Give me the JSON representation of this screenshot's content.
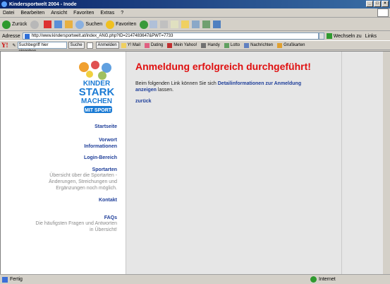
{
  "window": {
    "title": "Kindersportwelt 2004 - Inode"
  },
  "menu": {
    "items": [
      "Datei",
      "Bearbeiten",
      "Ansicht",
      "Favoriten",
      "Extras",
      "?"
    ]
  },
  "toolbar": {
    "back_label": "Zurück",
    "search_label": "Suchen",
    "favorites_label": "Favoriten"
  },
  "address": {
    "label": "Adresse",
    "url": "http://www.kindersportwelt.at/index_ANG.php?ID=2147483647&PWT=7733",
    "go_label": "Wechseln zu",
    "links_label": "Links"
  },
  "yahoo": {
    "logo": "Y!",
    "search_placeholder": "Suchbegriff hier eingeben",
    "search_button": "Suche",
    "login_button": "Anmelden",
    "items": [
      "Y! Mail",
      "Dating",
      "Mein Yahoo!",
      "Handy",
      "Lotto",
      "Nachrichten",
      "Grußkarten"
    ]
  },
  "logo": {
    "line1": "KINDER",
    "line2": "STARK",
    "line3": "MACHEN",
    "line4": "MIT SPORT"
  },
  "sidebar": {
    "startseite": "Startseite",
    "vorwort": "Vorwort Informationen",
    "login": "Login-Bereich",
    "sportarten": "Sportarten",
    "sportarten_desc": "Übersicht über die Sportarten - Änderungen, Streichungen und Ergänzungen noch möglich.",
    "kontakt": "Kontakt",
    "faqs": "FAQs",
    "faqs_desc": "Die häufigsten Fragen und Antworten in Übersicht!"
  },
  "main": {
    "heading": "Anmeldung erfolgreich durchgeführt!",
    "para_before": "Beim folgenden Link können Sie sich ",
    "para_link": "Detailinformationen zur Anmeldung anzeigen",
    "para_after": " lassen.",
    "back_link": "zurück"
  },
  "status": {
    "text": "Fertig",
    "zone": "Internet"
  }
}
